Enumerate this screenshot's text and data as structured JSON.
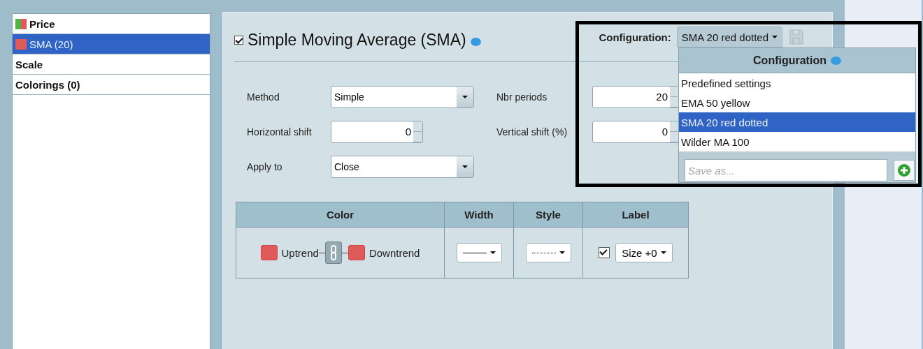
{
  "sidebar": {
    "items": [
      {
        "label": "Price",
        "swatches": [
          {
            "color": "#4fb548"
          },
          {
            "color": "#e05a5a"
          }
        ],
        "selected": false
      },
      {
        "label": "SMA (20)",
        "swatches": [
          {
            "color": "#e05a5a"
          }
        ],
        "selected": true
      },
      {
        "label": "Scale",
        "selected": false
      },
      {
        "label": "Colorings (0)",
        "selected": false
      }
    ]
  },
  "header": {
    "enabled": true,
    "title": "Simple Moving Average (SMA)",
    "configuration_label": "Configuration:",
    "configuration_value": "SMA 20 red dotted",
    "save_disabled": true
  },
  "fields": [
    {
      "kind": "select",
      "label": "Method",
      "value": "Simple"
    },
    {
      "kind": "spinner",
      "label": "Nbr periods",
      "value": "20"
    },
    {
      "kind": "spinner",
      "label": "Horizontal shift",
      "value": "0"
    },
    {
      "kind": "spinner",
      "label": "Vertical shift (%)",
      "value": "0"
    },
    {
      "kind": "select",
      "label": "Apply to",
      "value": "Close"
    }
  ],
  "style_table": {
    "columns": [
      "Color",
      "Width",
      "Style",
      "Label"
    ],
    "uptrend": {
      "label": "Uptrend",
      "color": "#e05a5a"
    },
    "linked": true,
    "downtrend": {
      "label": "Downtrend",
      "color": "#e05a5a"
    },
    "width_dropdown": {
      "kind": "solid"
    },
    "style_dropdown": {
      "kind": "dotted"
    },
    "label_checked": true,
    "label_size": "Size +0"
  },
  "configuration_menu": {
    "title": "Configuration",
    "items": [
      {
        "label": "Predefined settings",
        "selected": false
      },
      {
        "label": "EMA 50 yellow",
        "selected": false
      },
      {
        "label": "SMA 20 red dotted",
        "selected": true
      },
      {
        "label": "Wilder MA 100",
        "selected": false
      }
    ],
    "save_placeholder": "Save as..."
  }
}
